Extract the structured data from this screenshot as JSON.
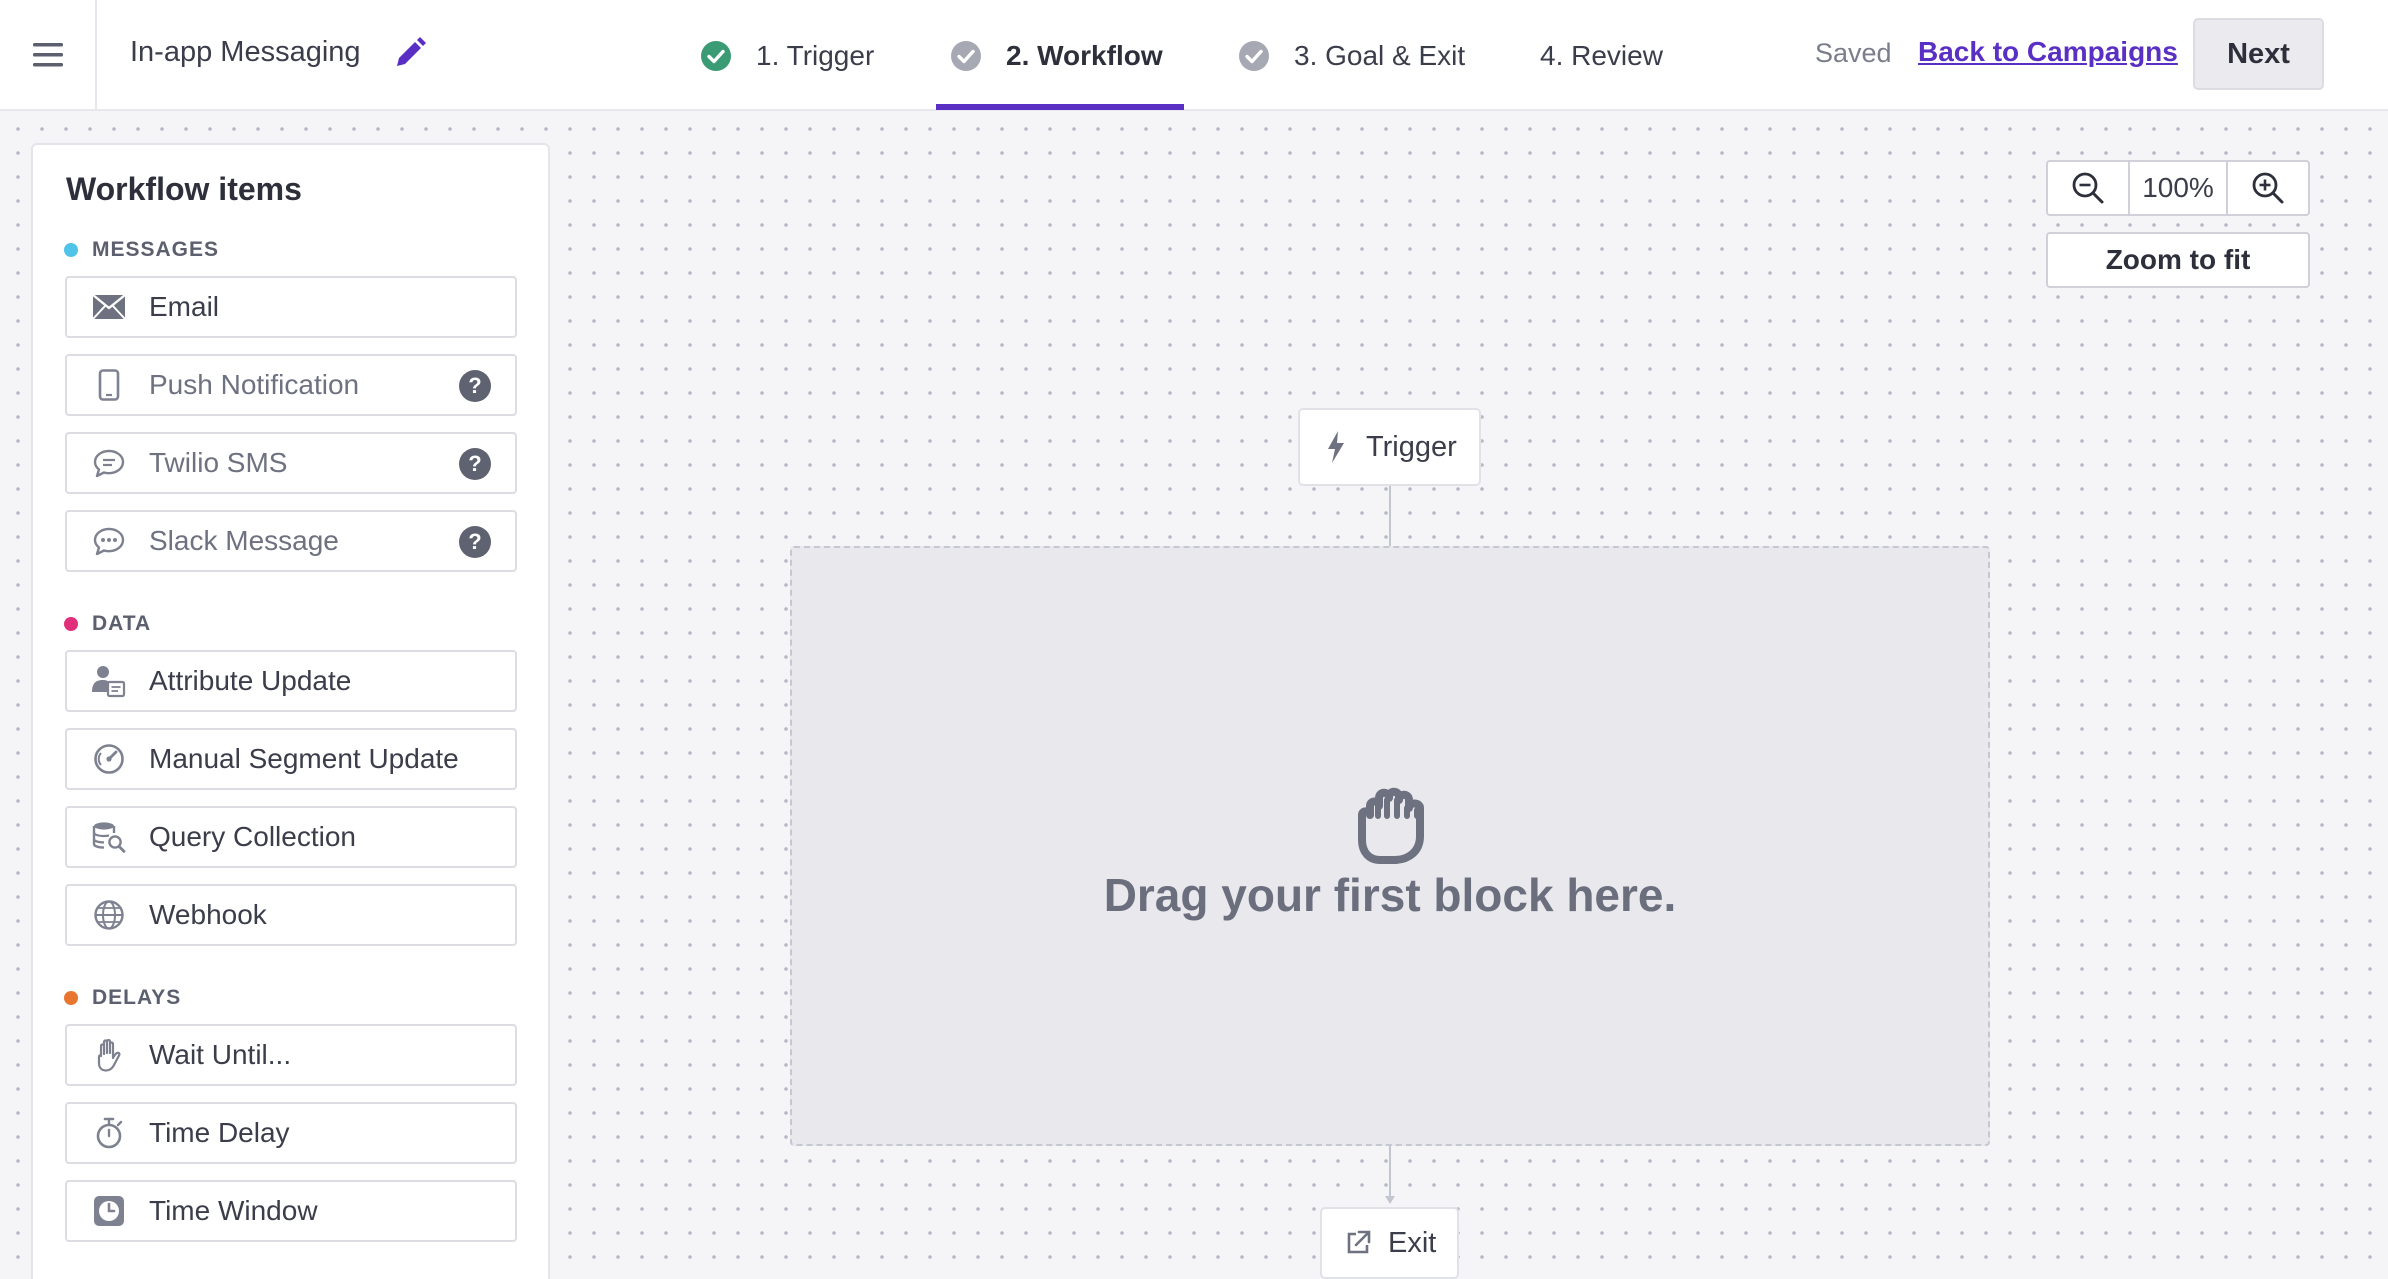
{
  "header": {
    "campaign_name": "In-app Messaging",
    "steps": [
      {
        "label": "1. Trigger",
        "status": "complete"
      },
      {
        "label": "2. Workflow",
        "status": "active"
      },
      {
        "label": "3. Goal & Exit",
        "status": "pending"
      },
      {
        "label": "4. Review",
        "status": "none"
      }
    ],
    "saved_label": "Saved",
    "back_link": "Back to Campaigns",
    "next_label": "Next"
  },
  "sidebar": {
    "title": "Workflow items",
    "sections": [
      {
        "title": "MESSAGES",
        "color": "#4fc3e8",
        "items": [
          {
            "label": "Email",
            "icon": "envelope-icon",
            "enabled": true
          },
          {
            "label": "Push Notification",
            "icon": "phone-icon",
            "enabled": false,
            "help": "?"
          },
          {
            "label": "Twilio SMS",
            "icon": "sms-bubble-icon",
            "enabled": false,
            "help": "?"
          },
          {
            "label": "Slack Message",
            "icon": "chat-bubble-icon",
            "enabled": false,
            "help": "?"
          }
        ]
      },
      {
        "title": "DATA",
        "color": "#e0307a",
        "items": [
          {
            "label": "Attribute Update",
            "icon": "user-card-icon",
            "enabled": true
          },
          {
            "label": "Manual Segment Update",
            "icon": "gauge-icon",
            "enabled": true
          },
          {
            "label": "Query Collection",
            "icon": "database-search-icon",
            "enabled": true
          },
          {
            "label": "Webhook",
            "icon": "globe-icon",
            "enabled": true
          }
        ]
      },
      {
        "title": "DELAYS",
        "color": "#e8762e",
        "items": [
          {
            "label": "Wait Until...",
            "icon": "hand-icon",
            "enabled": true
          },
          {
            "label": "Time Delay",
            "icon": "stopwatch-icon",
            "enabled": true
          },
          {
            "label": "Time Window",
            "icon": "clock-icon",
            "enabled": true
          }
        ]
      }
    ]
  },
  "zoom": {
    "level": "100%",
    "fit_label": "Zoom to fit"
  },
  "flow": {
    "trigger_label": "Trigger",
    "dropzone_text": "Drag your first block here.",
    "exit_label": "Exit"
  },
  "colors": {
    "accent": "#5a2fc4",
    "complete_check": "#3a9b74",
    "pending_check": "#a6a8b4"
  }
}
